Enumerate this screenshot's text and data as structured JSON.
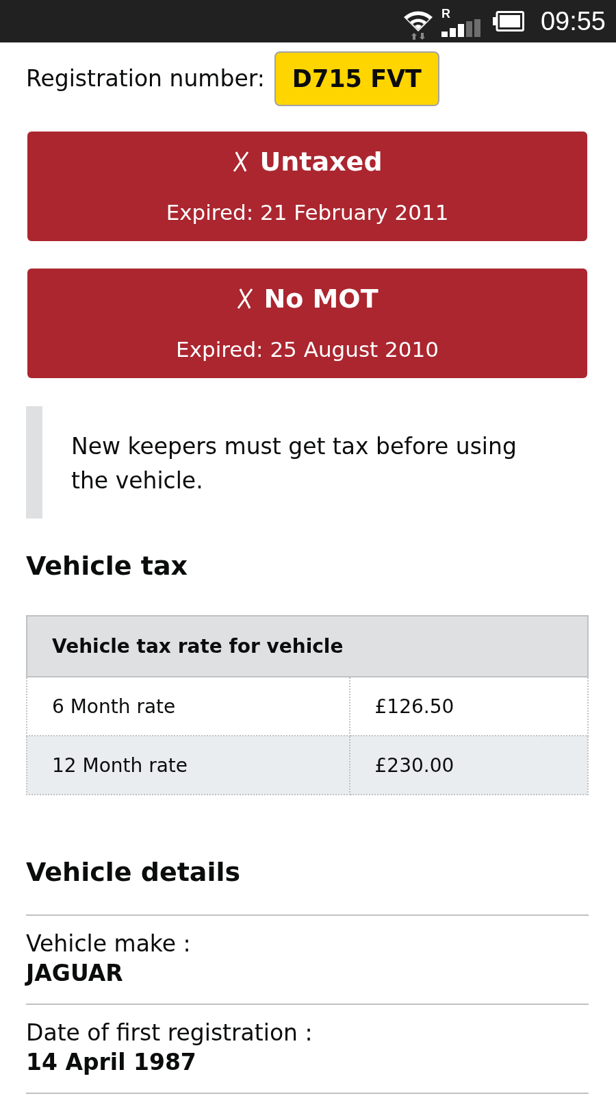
{
  "status_bar": {
    "network_label": "R",
    "time": "09:55"
  },
  "registration": {
    "label": "Registration number:",
    "plate": "D715 FVT"
  },
  "status_panels": [
    {
      "kind": "fail",
      "title": "Untaxed",
      "detail": "Expired: 21 February 2011"
    },
    {
      "kind": "fail",
      "title": "No MOT",
      "detail": "Expired: 25 August 2010"
    }
  ],
  "notice": "New keepers must get tax before using the vehicle.",
  "tax_section": {
    "heading": "Vehicle tax",
    "table": {
      "header": "Vehicle tax rate for vehicle",
      "rows": [
        [
          "6 Month rate",
          "£126.50"
        ],
        [
          "12 Month rate",
          "£230.00"
        ]
      ]
    }
  },
  "details_section": {
    "heading": "Vehicle details",
    "items": [
      {
        "label": "Vehicle make :",
        "value": "JAGUAR"
      },
      {
        "label": "Date of first registration :",
        "value": "14 April 1987"
      }
    ]
  }
}
